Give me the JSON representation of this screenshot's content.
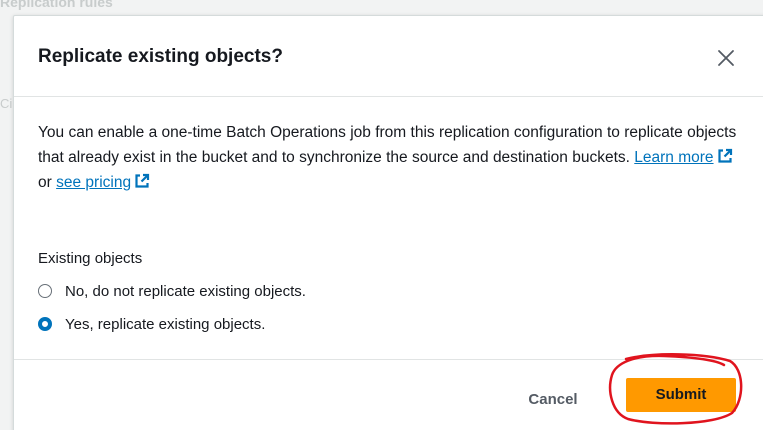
{
  "background": {
    "heading": "Replication rules",
    "edge_text": "Ci"
  },
  "modal": {
    "title": "Replicate existing objects?",
    "close_icon": "close-icon",
    "description_text": "You can enable a one-time Batch Operations job from this replication configuration to replicate objects that already exist in the bucket and to synchronize the source and destination buckets.",
    "learn_more_label": "Learn more",
    "or_text": "or",
    "see_pricing_label": "see pricing",
    "external_link_icon": "external-link-icon",
    "group_label": "Existing objects",
    "options": [
      {
        "label": "No, do not replicate existing objects.",
        "selected": false
      },
      {
        "label": "Yes, replicate existing objects.",
        "selected": true
      }
    ],
    "cancel_label": "Cancel",
    "submit_label": "Submit"
  },
  "colors": {
    "primary_button": "#ff9900",
    "link": "#0073bb",
    "radio_selected": "#0073bb",
    "annotation_circle": "#e0141e"
  }
}
